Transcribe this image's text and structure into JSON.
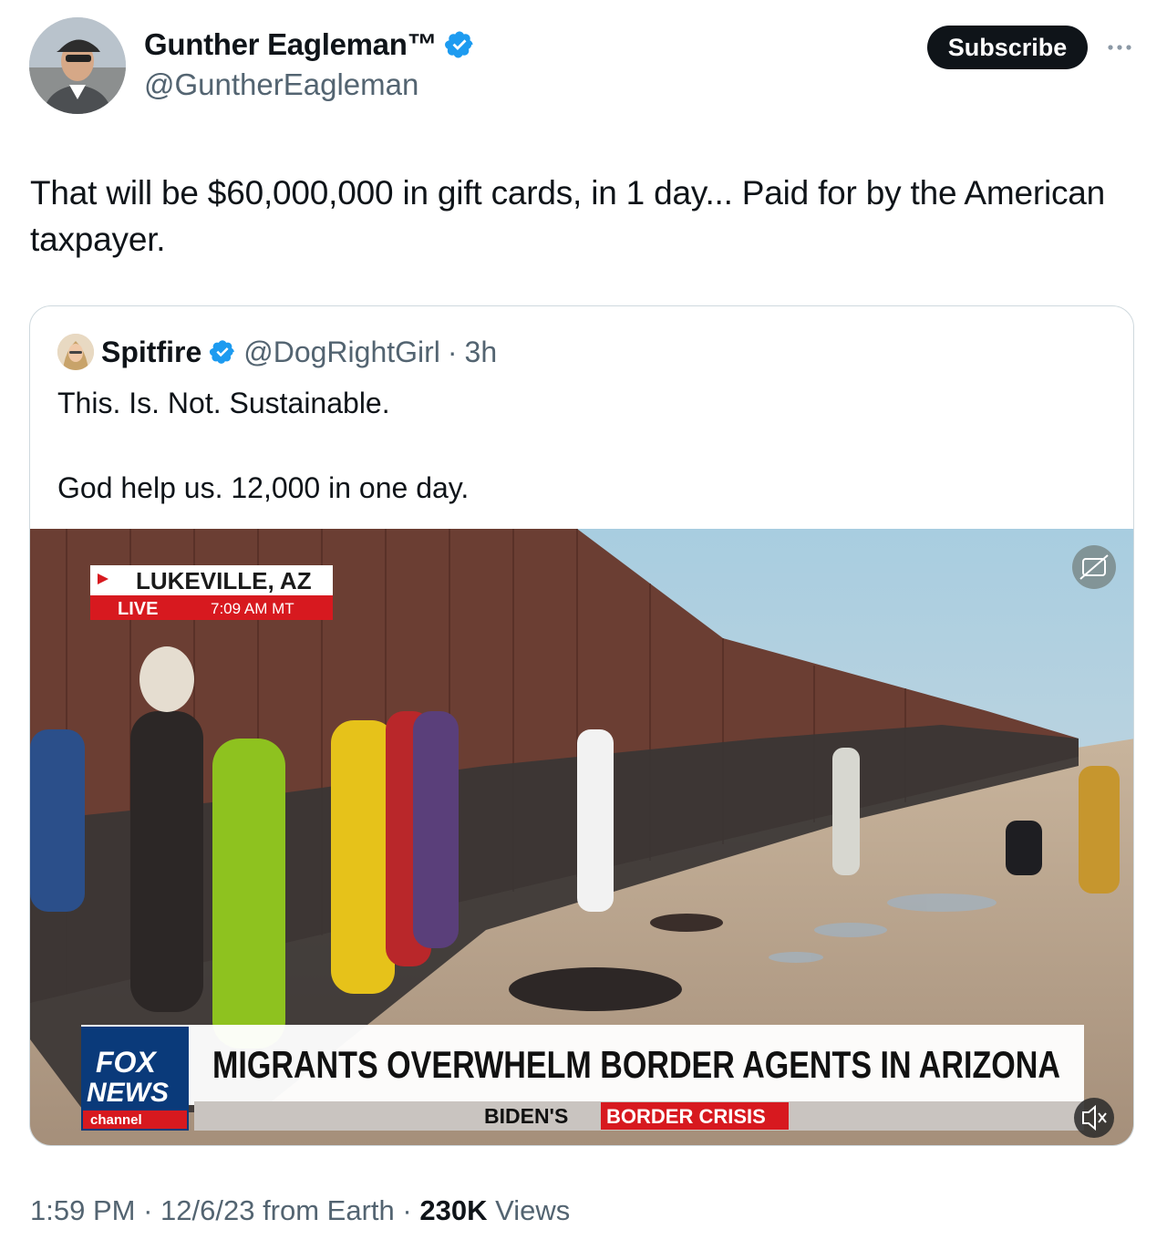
{
  "author": {
    "name": "Gunther Eagleman™",
    "handle": "@GuntherEagleman",
    "verified": true,
    "avatar_icon": "profile-photo"
  },
  "actions": {
    "subscribe_label": "Subscribe",
    "more_icon": "more-horizontal-icon"
  },
  "tweet": {
    "text": "That will be $60,000,000 in gift cards, in 1 day... Paid for by the American taxpayer."
  },
  "quoted": {
    "name": "Spitfire",
    "handle": "@DogRightGirl",
    "separator": "·",
    "time": "3h",
    "verified": true,
    "text_line1": "This. Is. Not. Sustainable.",
    "text_line2": "God help us. 12,000 in one day.",
    "media": {
      "location": "LUKEVILLE, AZ",
      "live_label": "LIVE",
      "live_time": "7:09 AM MT",
      "headline": "MIGRANTS OVERWHELM BORDER AGENTS IN ARIZONA",
      "ticker_prefix": "BIDEN'S",
      "ticker_highlight": "BORDER CRISIS",
      "network_top": "FOX",
      "network_mid": "NEWS",
      "network_bottom": "channel",
      "caption_icon": "captions-off-icon",
      "mute_icon": "volume-muted-icon",
      "colors": {
        "live_red": "#d7191f",
        "fox_blue": "#0a3a7a",
        "crisis_red": "#d7191f"
      }
    }
  },
  "footer": {
    "time": "1:59 PM",
    "sep1": "·",
    "date": "12/6/23 from Earth",
    "sep2": "·",
    "views_count": "230K",
    "views_label": "Views"
  },
  "colors": {
    "verified_blue": "#1d9bf0",
    "text_secondary": "#536471",
    "border": "#cfd9de"
  }
}
